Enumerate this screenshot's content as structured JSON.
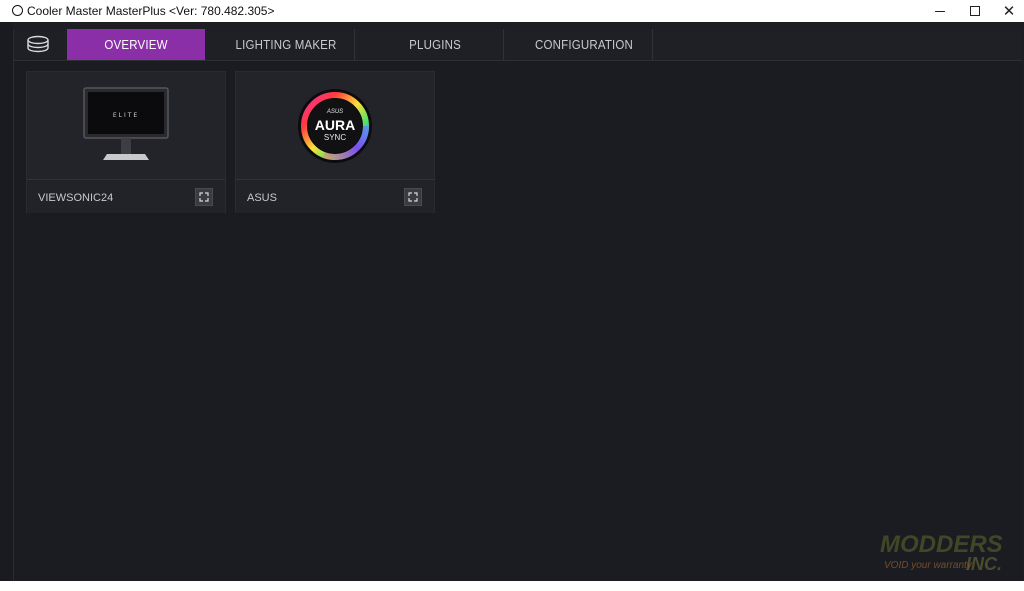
{
  "window": {
    "title": "Cooler Master MasterPlus <Ver: 780.482.305>",
    "minimize_icon": "minimize-icon",
    "maximize_icon": "maximize-icon",
    "close_label": "✕"
  },
  "navbar": {
    "logo_icon": "device-stack-icon",
    "tabs": [
      {
        "label": "OVERVIEW",
        "active": true
      },
      {
        "label": "LIGHTING MAKER",
        "active": false
      },
      {
        "label": "PLUGINS",
        "active": false
      },
      {
        "label": "CONFIGURATION",
        "active": false
      }
    ],
    "accent_color": "#8a2fa8"
  },
  "devices": [
    {
      "name": "VIEWSONIC24",
      "image": "monitor-image",
      "screen_text": "ELITE",
      "expand_icon": "expand-icon"
    },
    {
      "name": "ASUS",
      "image": "aura-sync-logo",
      "logo_brand": "ASUS",
      "logo_title": "AURA",
      "logo_sub": "SYNC",
      "expand_icon": "expand-icon"
    }
  ],
  "watermark": {
    "line1": "MODDERS",
    "line2": "INC.",
    "tag": "VOID your warranty"
  }
}
